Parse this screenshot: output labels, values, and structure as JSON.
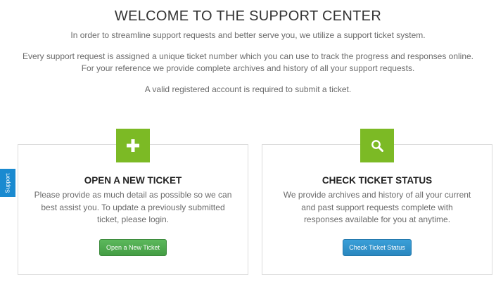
{
  "header": {
    "title": "WELCOME TO THE SUPPORT CENTER",
    "intro_line1": "In order to streamline support requests and better serve you, we utilize a support ticket system.",
    "intro_line2a": "Every support request is assigned a unique ticket number which you can use to track the progress and responses online.",
    "intro_line2b": "For your reference we provide complete archives and history of all your support requests.",
    "intro_line3": "A valid registered account is required to submit a ticket."
  },
  "cards": [
    {
      "icon": "plus-icon",
      "title": "OPEN A NEW TICKET",
      "text_line1": "Please provide as much detail as possible so we can",
      "text_line2": "best assist you. To update a previously submitted",
      "text_line3": "ticket, please login.",
      "button_label": "Open a New Ticket",
      "button_color": "#4cae4c"
    },
    {
      "icon": "search-icon",
      "title": "CHECK TICKET STATUS",
      "text_line1": "We provide archives and history of all your current",
      "text_line2": "and past support requests complete with",
      "text_line3": "responses available for you at anytime.",
      "button_label": "Check Ticket Status",
      "button_color": "#2a8dc8"
    }
  ],
  "side_tab": {
    "label": "Support",
    "color": "#1a8ad0"
  },
  "colors": {
    "icon_background": "#7cba25"
  }
}
